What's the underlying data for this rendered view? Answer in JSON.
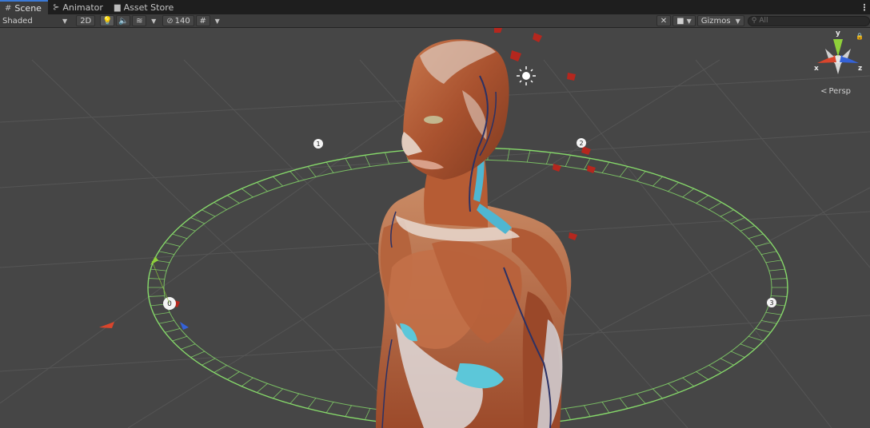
{
  "tabs": [
    {
      "label": "Scene",
      "icon": "grid-icon",
      "active": true
    },
    {
      "label": "Animator",
      "icon": "animator-icon",
      "active": false
    },
    {
      "label": "Asset Store",
      "icon": "bag-icon",
      "active": false
    }
  ],
  "toolbar": {
    "draw_mode": "Shaded",
    "mode_2d": "2D",
    "hidden_count": "140",
    "gizmos_label": "Gizmos",
    "search_placeholder": "All"
  },
  "gizmo": {
    "y_label": "y",
    "x_label": "x",
    "z_label": "z",
    "projection": "Persp"
  },
  "waypoints": [
    "1",
    "2",
    "3",
    "0"
  ],
  "colors": {
    "accent": "#3a79d6",
    "ring": "#86d96a",
    "axis_x": "#d9452c",
    "axis_y": "#8fd13a",
    "axis_z": "#3462d8"
  }
}
